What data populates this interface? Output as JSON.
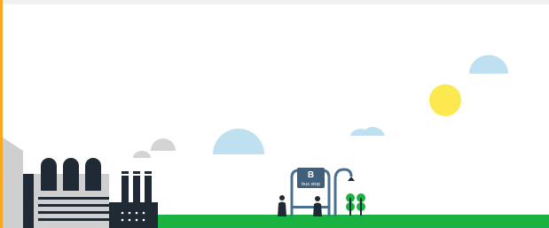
{
  "colors": {
    "accent": "#f6a821",
    "ground": "#1ab341",
    "sun": "#fbe94f",
    "cloud_light": "#bfe0f1",
    "cloud_grey": "#d4d4d4",
    "building_dark": "#1f2a35",
    "building_grey": "#cfcfcf",
    "bus_stop_frame": "#4c6f8f",
    "bus_stop_sign": "#3f5f7d",
    "tree": "#1ab341"
  },
  "bus_stop": {
    "letter": "B",
    "caption": "bus stop"
  },
  "icons": [
    "sun-icon",
    "cloud-icon",
    "factory-icon",
    "bus-stop-icon",
    "person-icon",
    "tree-icon"
  ]
}
